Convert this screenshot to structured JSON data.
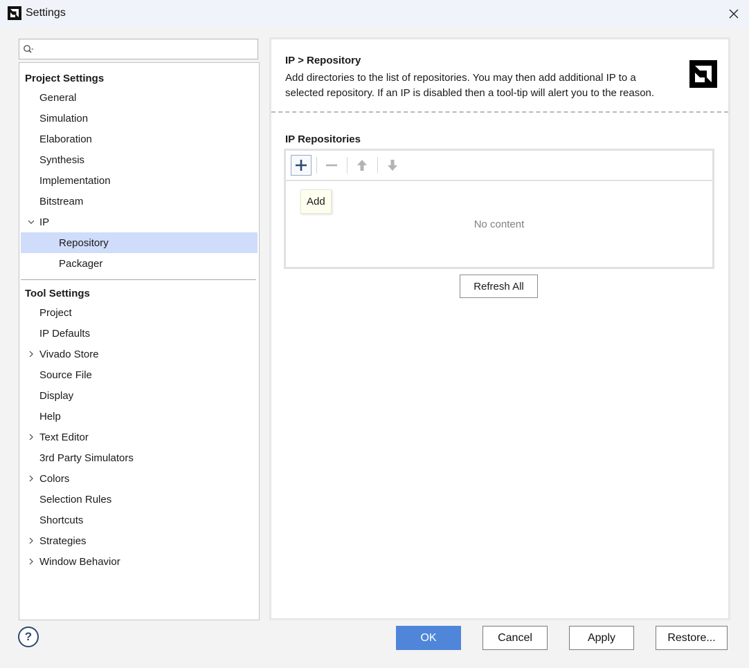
{
  "window": {
    "title": "Settings"
  },
  "search": {
    "placeholder": ""
  },
  "tree": {
    "project_settings": {
      "label": "Project Settings",
      "items": [
        "General",
        "Simulation",
        "Elaboration",
        "Synthesis",
        "Implementation",
        "Bitstream"
      ],
      "ip": {
        "label": "IP",
        "children": [
          "Repository",
          "Packager"
        ],
        "selected": "Repository"
      }
    },
    "tool_settings": {
      "label": "Tool Settings",
      "items": [
        {
          "label": "Project",
          "expandable": false
        },
        {
          "label": "IP Defaults",
          "expandable": false
        },
        {
          "label": "Vivado Store",
          "expandable": true
        },
        {
          "label": "Source File",
          "expandable": false
        },
        {
          "label": "Display",
          "expandable": false
        },
        {
          "label": "Help",
          "expandable": false
        },
        {
          "label": "Text Editor",
          "expandable": true
        },
        {
          "label": "3rd Party Simulators",
          "expandable": false
        },
        {
          "label": "Colors",
          "expandable": true
        },
        {
          "label": "Selection Rules",
          "expandable": false
        },
        {
          "label": "Shortcuts",
          "expandable": false
        },
        {
          "label": "Strategies",
          "expandable": true
        },
        {
          "label": "Window Behavior",
          "expandable": true
        }
      ]
    }
  },
  "content": {
    "breadcrumb": "IP > Repository",
    "description": "Add directories to the list of repositories. You may then add additional IP to a selected repository. If an IP is disabled then a tool-tip will alert you to the reason.",
    "section_label": "IP Repositories",
    "toolbar": {
      "add_icon": "plus-icon",
      "remove_icon": "minus-icon",
      "up_icon": "arrow-up-icon",
      "down_icon": "arrow-down-icon"
    },
    "tooltip": "Add",
    "empty_text": "No content",
    "refresh_label": "Refresh All"
  },
  "footer": {
    "help": "?",
    "ok": "OK",
    "cancel": "Cancel",
    "apply": "Apply",
    "restore": "Restore..."
  },
  "colors": {
    "accent": "#4f86d9",
    "selected_row": "#cfdcfa",
    "icon_dark": "#2d4a73"
  }
}
